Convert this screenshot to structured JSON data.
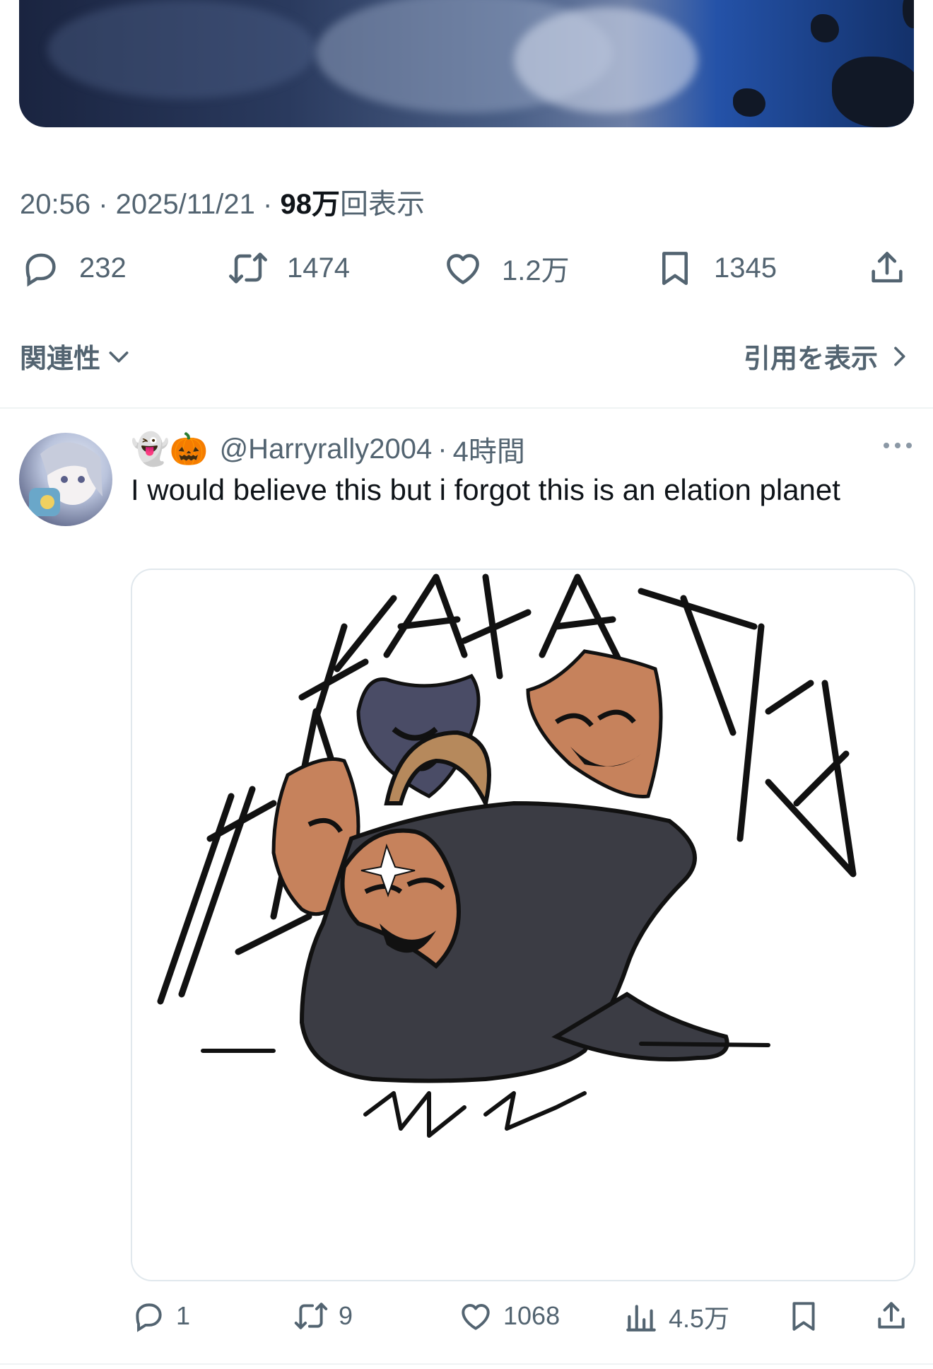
{
  "tweet": {
    "time": "20:56",
    "date": "2025/11/21",
    "views_count": "98万",
    "views_suffix": "回表示",
    "actions": {
      "replies": "232",
      "retweets": "1474",
      "likes": "1.2万",
      "bookmarks": "1345"
    }
  },
  "sort": {
    "label": "関連性"
  },
  "quotes": {
    "label": "引用を表示"
  },
  "reply": {
    "emojis": "👻🎃",
    "handle": "@Harryrally2004",
    "time": "4時間",
    "text": "I would believe this but i forgot this is an elation planet",
    "image_text": "HA HA HA HA HA HA HA",
    "actions": {
      "replies": "1",
      "retweets": "9",
      "likes": "1068",
      "views": "4.5万"
    }
  },
  "icons": [
    "reply-icon",
    "retweet-icon",
    "like-icon",
    "bookmark-icon",
    "share-icon",
    "chevron-down-icon",
    "chevron-right-icon",
    "more-icon",
    "views-icon"
  ],
  "colors": {
    "text": "#0f1419",
    "secondary": "#536471",
    "divider": "#eff3f4"
  }
}
